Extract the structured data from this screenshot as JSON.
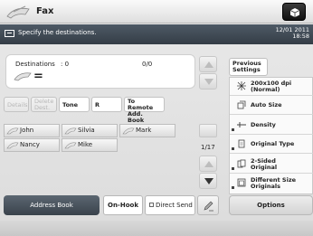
{
  "header": {
    "title": "Fax"
  },
  "status": {
    "message": "Specify the destinations.",
    "date": "12/01 2011",
    "time": "18:58"
  },
  "destinations": {
    "label": "Destinations",
    "count": ": 0",
    "page": "0/0",
    "value": "="
  },
  "actions": [
    {
      "label": "Details",
      "enabled": false
    },
    {
      "label": "Delete Dest.",
      "enabled": false
    },
    {
      "label": "Tone",
      "enabled": true
    },
    {
      "label": "R",
      "enabled": true
    },
    {
      "label": "To Remote Add. Book",
      "enabled": true
    }
  ],
  "address_entries": [
    {
      "name": "John"
    },
    {
      "name": "Silvia"
    },
    {
      "name": "Mark"
    },
    {
      "name": "Nancy"
    },
    {
      "name": "Mike"
    }
  ],
  "pager": {
    "page": "1/17"
  },
  "bottom": {
    "address_book": "Address Book",
    "on_hook": "On-Hook",
    "direct_send": "Direct Send"
  },
  "right": {
    "previous_settings": "Previous Settings",
    "settings": [
      {
        "label": "200x100 dpi (Normal)",
        "icon": "resolution-icon"
      },
      {
        "label": "Auto Size",
        "icon": "auto-size-icon"
      },
      {
        "label": "Density",
        "icon": "density-icon"
      },
      {
        "label": "Original Type",
        "icon": "original-type-icon"
      },
      {
        "label": "2-Sided Original",
        "icon": "two-sided-icon"
      },
      {
        "label": "Different Size Originals",
        "icon": "different-size-icon"
      }
    ],
    "options": "Options"
  }
}
